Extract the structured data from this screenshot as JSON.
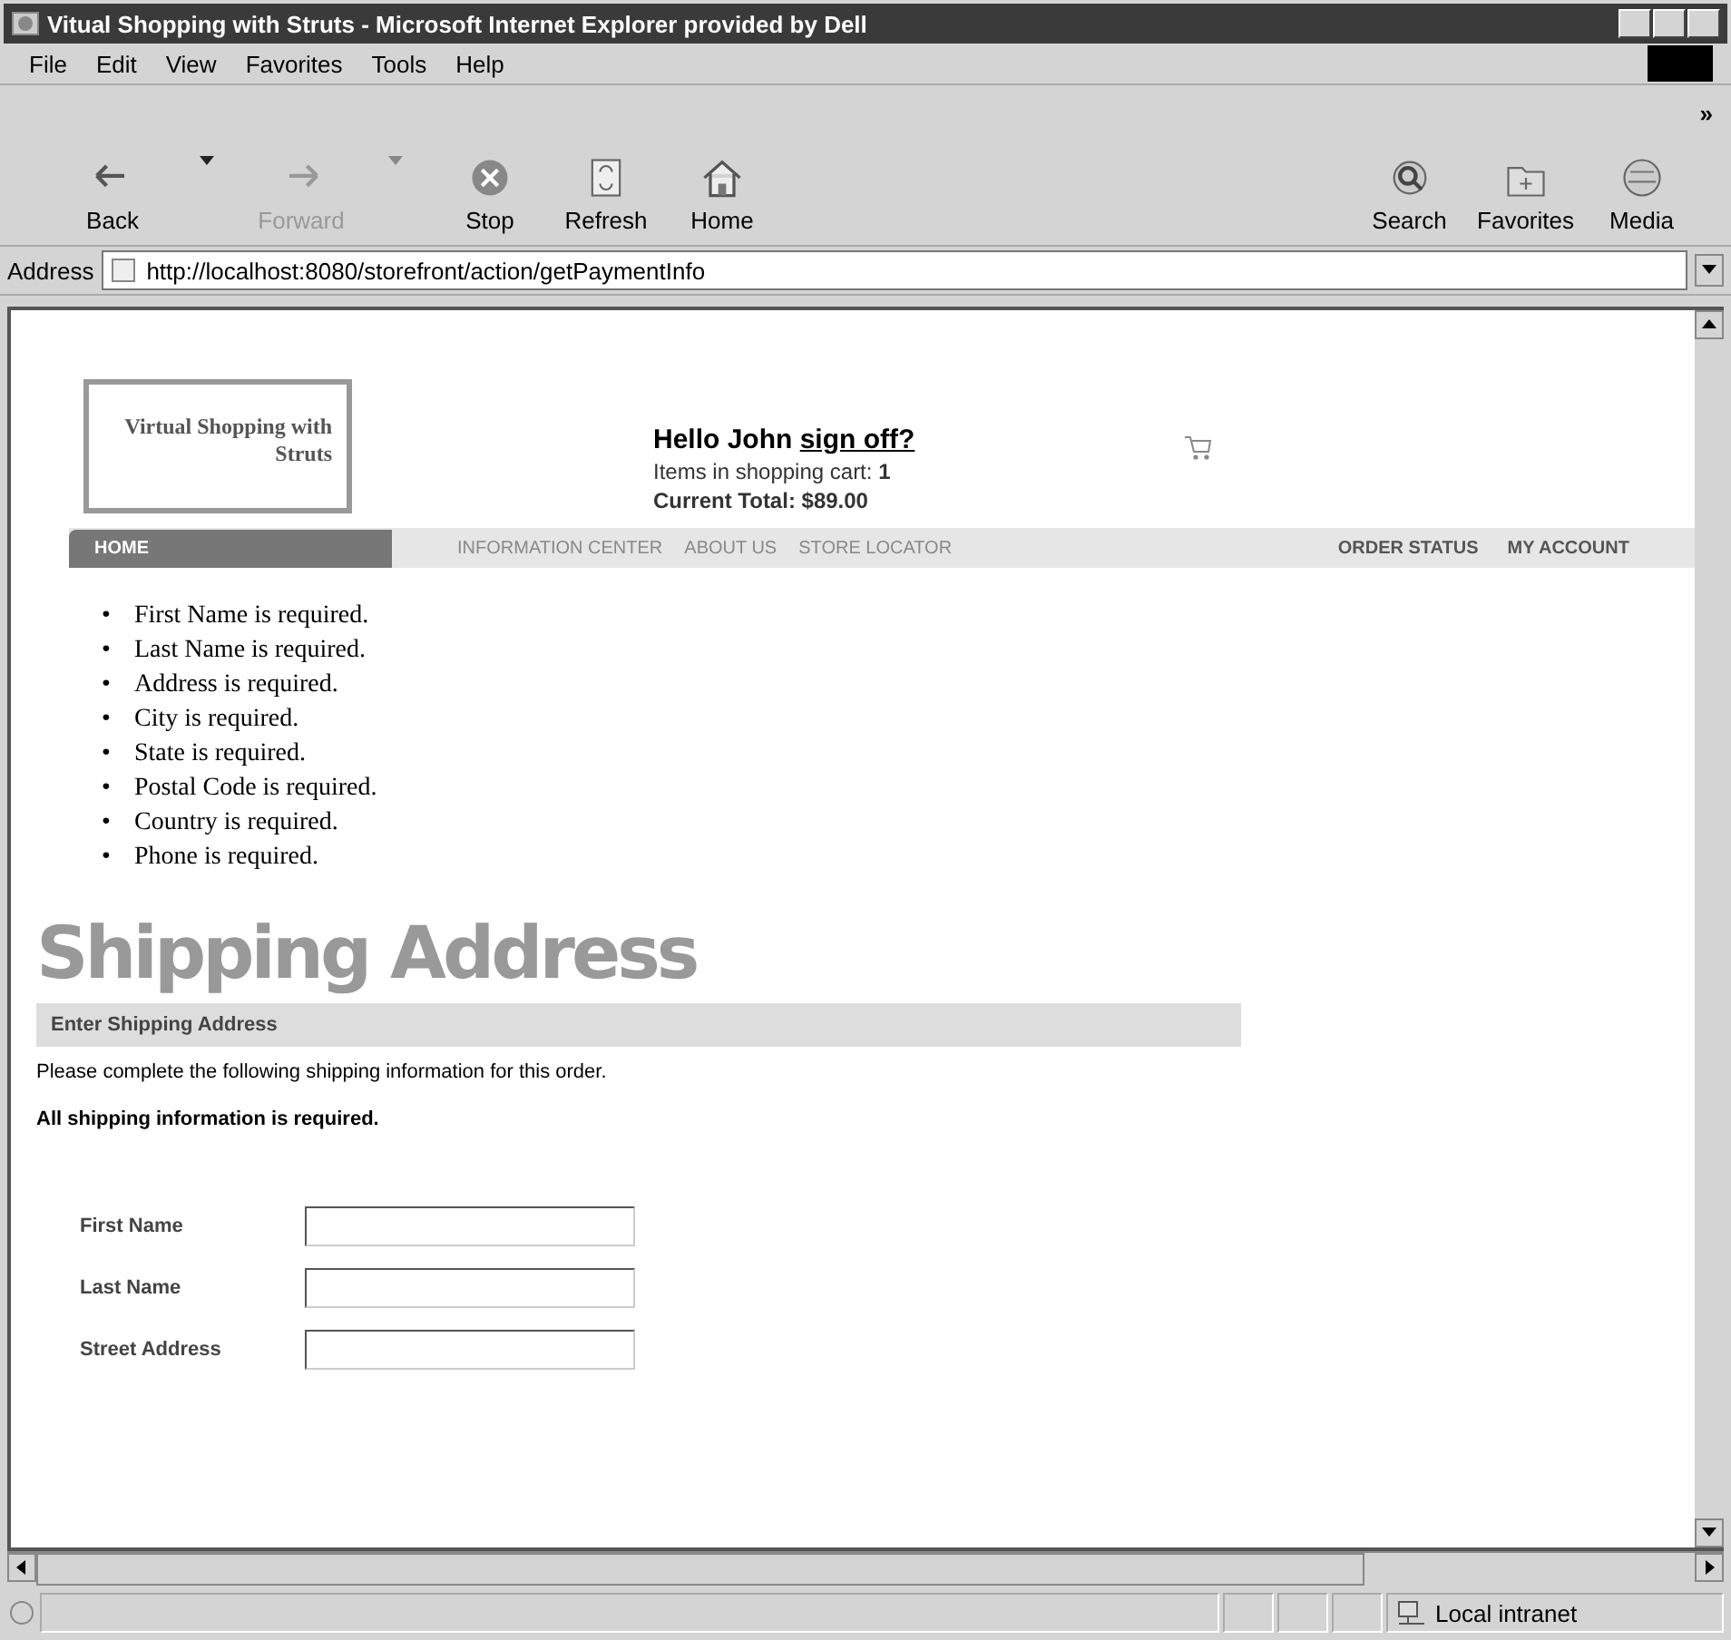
{
  "window": {
    "title": "Vitual Shopping with Struts - Microsoft Internet Explorer provided by Dell"
  },
  "menu": [
    "File",
    "Edit",
    "View",
    "Favorites",
    "Tools",
    "Help"
  ],
  "toolbar": [
    {
      "label": "Back",
      "kind": "back",
      "disabled": false,
      "dropdown": true
    },
    {
      "label": "Forward",
      "kind": "forward",
      "disabled": true,
      "dropdown": true
    },
    {
      "label": "Stop",
      "kind": "stop",
      "disabled": false,
      "dropdown": false
    },
    {
      "label": "Refresh",
      "kind": "refresh",
      "disabled": false,
      "dropdown": false
    },
    {
      "label": "Home",
      "kind": "home",
      "disabled": false,
      "dropdown": false
    },
    {
      "label": "Search",
      "kind": "search",
      "disabled": false,
      "dropdown": false
    },
    {
      "label": "Favorites",
      "kind": "favorites",
      "disabled": false,
      "dropdown": false
    },
    {
      "label": "Media",
      "kind": "media",
      "disabled": false,
      "dropdown": false
    }
  ],
  "toolbar_more": "»",
  "address": {
    "label": "Address",
    "value": "http://localhost:8080/storefront/action/getPaymentInfo"
  },
  "page": {
    "logo": "Virtual Shopping with Struts",
    "greeting": "Hello John",
    "sign_off": "sign off?",
    "cart_label": "Items in shopping cart:",
    "cart_count": "1",
    "total": "Current Total: $89.00",
    "nav": [
      {
        "label": "HOME",
        "selected": true
      },
      {
        "label": "INFORMATION CENTER",
        "selected": false
      },
      {
        "label": "ABOUT US",
        "selected": false
      },
      {
        "label": "STORE LOCATOR",
        "selected": false
      }
    ],
    "nav_right": [
      "ORDER STATUS",
      "MY ACCOUNT"
    ],
    "error_marker": "•",
    "errors": [
      "First Name is required.",
      "Last Name is required.",
      "Address is required.",
      "City is required.",
      "State is required.",
      "Postal Code is required.",
      "Country is required.",
      "Phone is required."
    ],
    "heading": "Shipping Address",
    "section": "Enter Shipping Address",
    "intro": "Please complete the following shipping information for this order.",
    "note": "All shipping information is required.",
    "fields": [
      "First Name",
      "Last Name",
      "Street Address"
    ]
  },
  "status_bar": {
    "zone": "Local intranet"
  }
}
